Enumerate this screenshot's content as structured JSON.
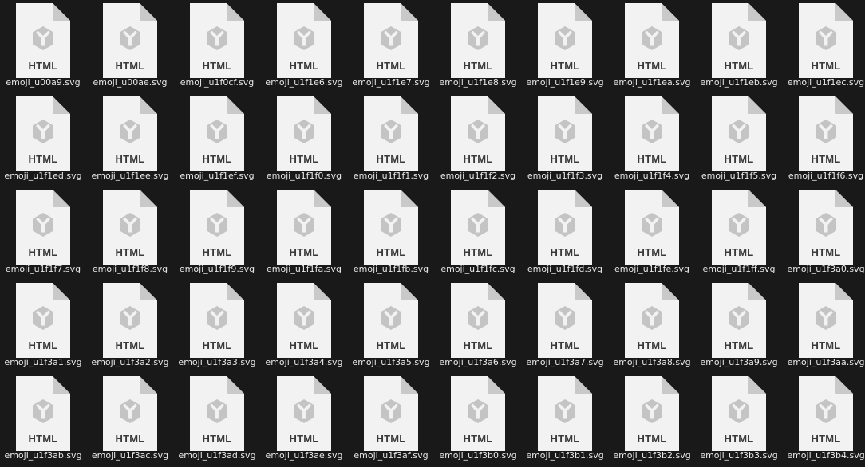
{
  "badge_text": "HTML",
  "icon": "html-file-icon",
  "colors": {
    "background": "#191919",
    "page": "#f2f2f2",
    "fold": "#c9c9c9",
    "emblem": "#c4c4c4",
    "label": "#e8e8e8"
  },
  "files": [
    "emoji_u00a9.svg",
    "emoji_u00ae.svg",
    "emoji_u1f0cf.svg",
    "emoji_u1f1e6.svg",
    "emoji_u1f1e7.svg",
    "emoji_u1f1e8.svg",
    "emoji_u1f1e9.svg",
    "emoji_u1f1ea.svg",
    "emoji_u1f1eb.svg",
    "emoji_u1f1ec.svg",
    "emoji_u1f1ed.svg",
    "emoji_u1f1ee.svg",
    "emoji_u1f1ef.svg",
    "emoji_u1f1f0.svg",
    "emoji_u1f1f1.svg",
    "emoji_u1f1f2.svg",
    "emoji_u1f1f3.svg",
    "emoji_u1f1f4.svg",
    "emoji_u1f1f5.svg",
    "emoji_u1f1f6.svg",
    "emoji_u1f1f7.svg",
    "emoji_u1f1f8.svg",
    "emoji_u1f1f9.svg",
    "emoji_u1f1fa.svg",
    "emoji_u1f1fb.svg",
    "emoji_u1f1fc.svg",
    "emoji_u1f1fd.svg",
    "emoji_u1f1fe.svg",
    "emoji_u1f1ff.svg",
    "emoji_u1f3a0.svg",
    "emoji_u1f3a1.svg",
    "emoji_u1f3a2.svg",
    "emoji_u1f3a3.svg",
    "emoji_u1f3a4.svg",
    "emoji_u1f3a5.svg",
    "emoji_u1f3a6.svg",
    "emoji_u1f3a7.svg",
    "emoji_u1f3a8.svg",
    "emoji_u1f3a9.svg",
    "emoji_u1f3aa.svg",
    "emoji_u1f3ab.svg",
    "emoji_u1f3ac.svg",
    "emoji_u1f3ad.svg",
    "emoji_u1f3ae.svg",
    "emoji_u1f3af.svg",
    "emoji_u1f3b0.svg",
    "emoji_u1f3b1.svg",
    "emoji_u1f3b2.svg",
    "emoji_u1f3b3.svg",
    "emoji_u1f3b4.svg"
  ]
}
